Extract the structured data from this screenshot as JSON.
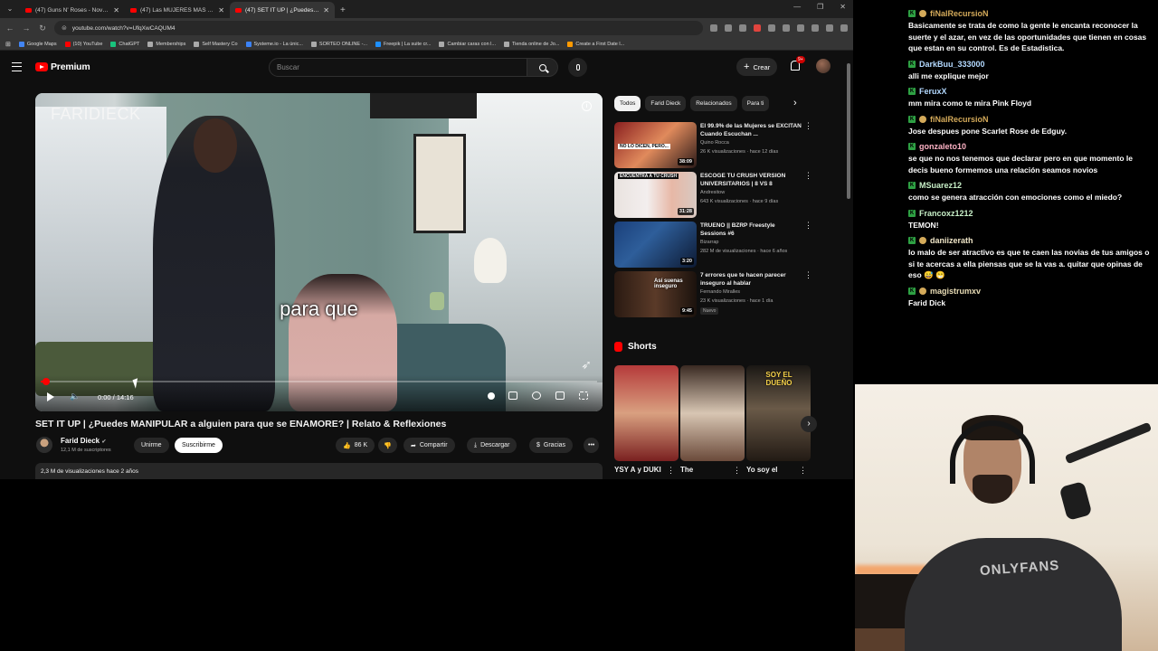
{
  "browser": {
    "tabs": [
      {
        "label": "(47) Guns N' Roses - Novembe",
        "active": false
      },
      {
        "label": "(47) Las MUJERES MÁS LINDA",
        "active": false
      },
      {
        "label": "(47) SET IT UP | ¿Puedes MANIP",
        "active": true
      }
    ],
    "url": "youtube.com/watch?v=UfqXwCAQUM4",
    "bookmarks": [
      {
        "label": "Google Maps",
        "icon": "maps-icon"
      },
      {
        "label": "(10) YouTube",
        "icon": "youtube-icon"
      },
      {
        "label": "ChatGPT",
        "icon": "chatgpt-icon"
      },
      {
        "label": "Memberships",
        "icon": "page-icon"
      },
      {
        "label": "Self Mastery Co",
        "icon": "page-icon"
      },
      {
        "label": "Systeme.io - La únic...",
        "icon": "systeme-icon"
      },
      {
        "label": "SORTEO ONLINE -...",
        "icon": "page-icon"
      },
      {
        "label": "Freepik | La suite cr...",
        "icon": "freepik-icon"
      },
      {
        "label": "Cambiar caras con l...",
        "icon": "globe-icon"
      },
      {
        "label": "Tienda online de Jo...",
        "icon": "page-icon"
      },
      {
        "label": "Create a First Date l...",
        "icon": "globe-icon"
      }
    ]
  },
  "youtube": {
    "logo": "Premium",
    "search_placeholder": "Buscar",
    "create_label": "Crear",
    "notif_badge": "9+",
    "player": {
      "brand": "FARIDIECK",
      "subtitle": "para que",
      "time": "0:00 / 14:16",
      "progress": 0.01
    },
    "video_title": "SET IT UP | ¿Puedes MANIPULAR a alguien para que se ENAMORE? | Relato & Reflexiones",
    "channel": {
      "name": "Farid Dieck",
      "subs": "12,1 M de suscriptores",
      "join": "Unirme",
      "subscribe": "Suscribirme"
    },
    "actions": {
      "likes": "86 K",
      "share": "Compartir",
      "download": "Descargar",
      "thanks": "Gracias"
    },
    "views_line": "2,3 M de visualizaciones  hace 2 años",
    "chips": [
      "Todos",
      "Farid Dieck",
      "Relacionados",
      "Para ti"
    ],
    "recommendations": [
      {
        "title": "El 99.9% de las Mujeres se EXCITAN Cuando Escuchan ...",
        "channel": "Quino Rocca",
        "meta": "26 K visualizaciones · hace 12 días",
        "duration": "38:09",
        "thumb_text": "NO LO DICEN, PERO...",
        "new": ""
      },
      {
        "title": "ESCOGE TU CRUSH VERSION UNIVERSITARIOS | 8 VS 8",
        "channel": "Andresitow",
        "meta": "643 K visualizaciones · hace 9 días",
        "duration": "31:28",
        "thumb_text": "ENCUENTRA A TU CRUSH",
        "new": ""
      },
      {
        "title": "TRUENO || BZRP Freestyle Sessions #6",
        "channel": "Bizarrap",
        "meta": "282 M de visualizaciones · hace 6 años",
        "duration": "3:20",
        "thumb_text": "",
        "new": ""
      },
      {
        "title": "7 errores que te hacen parecer inseguro al hablar",
        "channel": "Fernando Miralles",
        "meta": "23 K visualizaciones · hace 1 día",
        "duration": "9:45",
        "thumb_text": "Así suenas inseguro",
        "new": "Nuevo"
      }
    ],
    "shorts_title": "Shorts",
    "shorts": [
      {
        "title": "YSY A y DUKI",
        "thumb_text": ""
      },
      {
        "title": "The",
        "thumb_text": ""
      },
      {
        "title": "Yo soy el",
        "thumb_text": "SOY EL DUEÑO"
      }
    ]
  },
  "chat": [
    {
      "user": "fiNalRecursioN",
      "color": "#d4aa5a",
      "sub": true,
      "text": "Basicamente se trata de como la gente le encanta reconocer la suerte y el azar, en vez de las oportunidades que tienen en cosas que estan en su control. Es de Estadistica."
    },
    {
      "user": "DarkBuu_333000",
      "color": "#b3d9ff",
      "sub": false,
      "text": "alli me explique mejor"
    },
    {
      "user": "FeruxX",
      "color": "#b3d9ff",
      "sub": false,
      "text": "mm mira como te mira Pink Floyd"
    },
    {
      "user": "fiNalRecursioN",
      "color": "#d4aa5a",
      "sub": true,
      "text": "Jose despues pone Scarlet Rose de Edguy."
    },
    {
      "user": "gonzaleto10",
      "color": "#ffb3c6",
      "sub": false,
      "text": "se que no nos tenemos que declarar pero en que momento le decis bueno formemos una relación seamos novios"
    },
    {
      "user": "MSuarez12",
      "color": "#c8f0c8",
      "sub": false,
      "text": "como se genera atracción con emociones como el miedo?"
    },
    {
      "user": "Francoxz1212",
      "color": "#c8f0c8",
      "sub": false,
      "text": "TEMON!"
    },
    {
      "user": "daniizerath",
      "color": "#f0e6c8",
      "sub": true,
      "text": "lo malo de ser atractivo es que te caen las novias de tus amigos o si te acercas a ella piensas que se la vas a. quitar que opinas de eso 😅 😁"
    },
    {
      "user": "magistrumxv",
      "color": "#e8dcb5",
      "sub": true,
      "text": "Farid Dick"
    }
  ],
  "webcam": {
    "shirt_text": "ONLYFANS"
  }
}
